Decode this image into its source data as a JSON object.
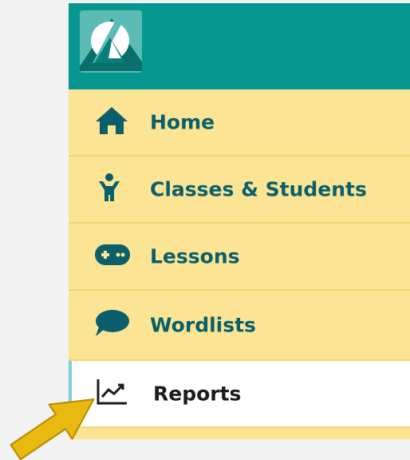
{
  "nav": {
    "items": [
      {
        "label": "Home",
        "icon": "home-icon"
      },
      {
        "label": "Classes & Students",
        "icon": "student-icon"
      },
      {
        "label": "Lessons",
        "icon": "gamepad-icon"
      },
      {
        "label": "Wordlists",
        "icon": "speech-bubble-icon"
      },
      {
        "label": "Reports",
        "icon": "chart-line-icon",
        "active": true
      }
    ]
  },
  "colors": {
    "header": "#079791",
    "sidebar": "#fbe594",
    "label": "#0b5e6b",
    "active_bg": "#ffffff",
    "arrow": "#e8b90f"
  }
}
